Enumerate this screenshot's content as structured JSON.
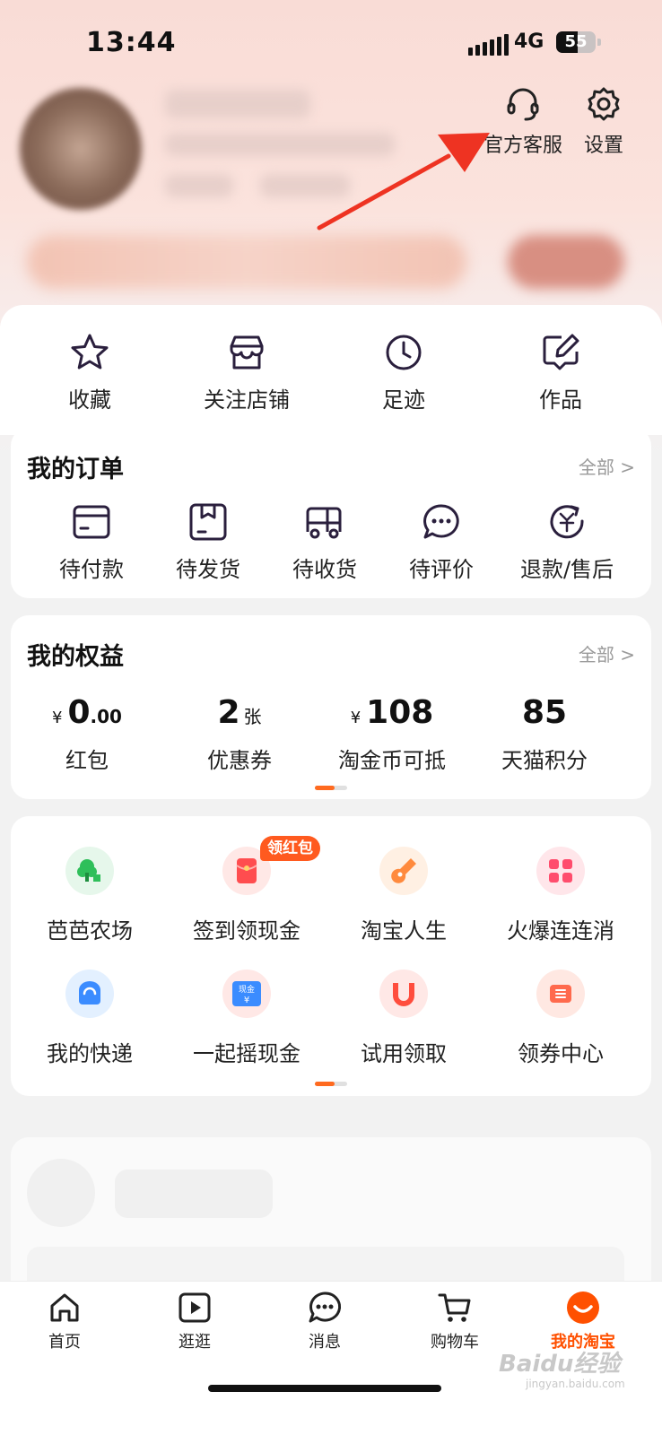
{
  "status_bar": {
    "time": "13:44",
    "network": "4G",
    "battery": "55",
    "battery_level": 0.55
  },
  "header": {
    "customer_service": "官方客服",
    "settings": "设置"
  },
  "quick_links": [
    {
      "label": "收藏",
      "icon": "star-icon"
    },
    {
      "label": "关注店铺",
      "icon": "store-icon"
    },
    {
      "label": "足迹",
      "icon": "clock-icon"
    },
    {
      "label": "作品",
      "icon": "edit-icon"
    }
  ],
  "orders": {
    "title": "我的订单",
    "more": "全部 >",
    "items": [
      {
        "label": "待付款",
        "icon": "wallet-icon"
      },
      {
        "label": "待发货",
        "icon": "package-icon"
      },
      {
        "label": "待收货",
        "icon": "truck-icon"
      },
      {
        "label": "待评价",
        "icon": "chat-icon"
      },
      {
        "label": "退款/售后",
        "icon": "refund-icon"
      }
    ]
  },
  "benefits": {
    "title": "我的权益",
    "more": "全部 >",
    "items": [
      {
        "currency": "¥",
        "value_int": "0",
        "value_dec": ".00",
        "unit": "",
        "label": "红包"
      },
      {
        "currency": "",
        "value_int": "2",
        "value_dec": "",
        "unit": "张",
        "label": "优惠券"
      },
      {
        "currency": "¥",
        "value_int": "108",
        "value_dec": "",
        "unit": "",
        "label": "淘金币可抵"
      },
      {
        "currency": "",
        "value_int": "85",
        "value_dec": "",
        "unit": "",
        "label": "天猫积分"
      }
    ]
  },
  "apps": {
    "badge": "领红包",
    "items": [
      {
        "label": "芭芭农场",
        "icon": "tree-icon",
        "color": "#2fbf5a"
      },
      {
        "label": "签到领现金",
        "icon": "red-packet-icon",
        "color": "#ff4d4f"
      },
      {
        "label": "淘宝人生",
        "icon": "guitar-icon",
        "color": "#ff8a3d"
      },
      {
        "label": "火爆连连消",
        "icon": "hearts-icon",
        "color": "#ff4d6d"
      },
      {
        "label": "我的快递",
        "icon": "courier-icon",
        "color": "#3b8cff"
      },
      {
        "label": "一起摇现金",
        "icon": "cash-icon",
        "color": "#3b8cff"
      },
      {
        "label": "试用领取",
        "icon": "magnet-icon",
        "color": "#ff4d3d"
      },
      {
        "label": "领券中心",
        "icon": "coupon-icon",
        "color": "#ff6a4d"
      }
    ],
    "cash_text": "现金",
    "cash_yen": "¥"
  },
  "tabbar": {
    "items": [
      {
        "label": "首页",
        "icon": "home-icon"
      },
      {
        "label": "逛逛",
        "icon": "video-icon"
      },
      {
        "label": "消息",
        "icon": "message-icon"
      },
      {
        "label": "购物车",
        "icon": "cart-icon"
      },
      {
        "label": "我的淘宝",
        "icon": "taobao-face-icon"
      }
    ],
    "active_color": "#ff5000"
  },
  "watermark": {
    "text": "Baidu经验",
    "sub": "jingyan.baidu.com"
  }
}
